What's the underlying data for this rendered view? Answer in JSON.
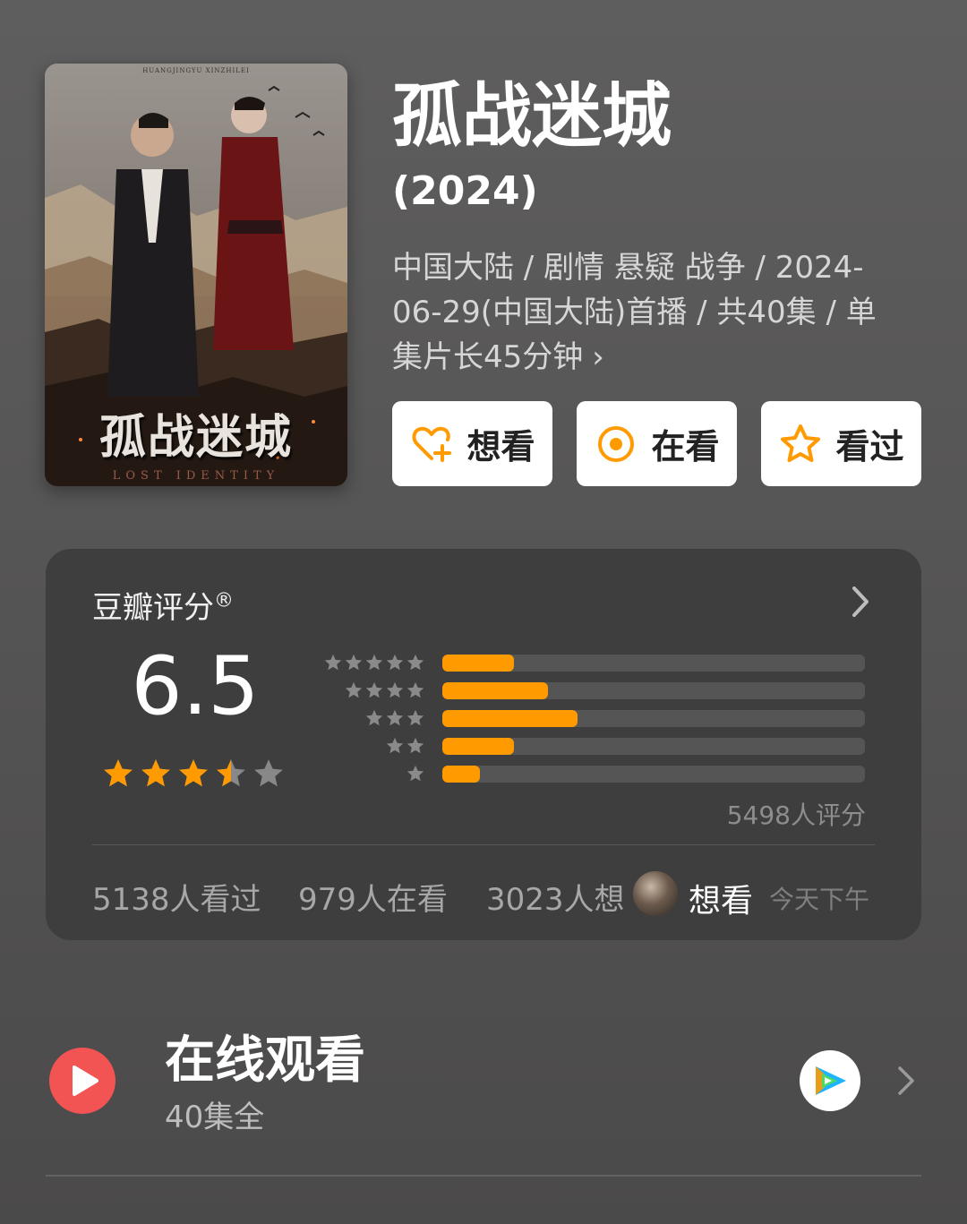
{
  "poster": {
    "credits": "HUANGJINGYU    XINZHILEI",
    "title": "孤战迷城",
    "subtitle": "LOST IDENTITY"
  },
  "movie": {
    "title": "孤战迷城",
    "year": "(2024)",
    "meta": "中国大陆 / 剧情 悬疑 战争 / 2024-06-29(中国大陆)首播 / 共40集 / 单集片长45分钟",
    "meta_chevron": "›"
  },
  "actions": {
    "want": "想看",
    "watching": "在看",
    "watched": "看过"
  },
  "rating": {
    "header": "豆瓣评分",
    "registered": "®",
    "score": "6.5",
    "stars": 3.5,
    "distribution": [
      {
        "stars": 5,
        "fraction": 0.17
      },
      {
        "stars": 4,
        "fraction": 0.25
      },
      {
        "stars": 3,
        "fraction": 0.32
      },
      {
        "stars": 2,
        "fraction": 0.17
      },
      {
        "stars": 1,
        "fraction": 0.09
      }
    ],
    "count": "5498人评分",
    "watched": "5138人看过",
    "watching": "979人在看",
    "wish": "3023人想",
    "friend_action": "想看",
    "friend_time": "今天下午"
  },
  "online": {
    "title": "在线观看",
    "subtitle": "40集全"
  },
  "colors": {
    "accent": "#ff9a00",
    "play": "#f25454",
    "star_empty": "#888888"
  }
}
